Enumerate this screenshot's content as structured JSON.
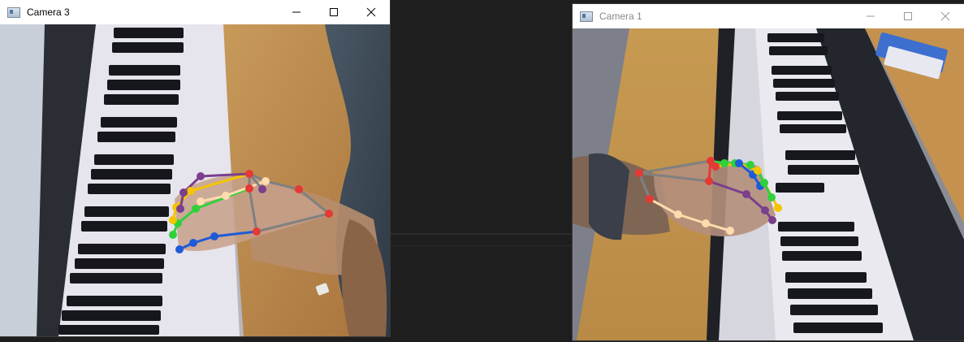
{
  "windows": {
    "camera3": {
      "title": "Camera 3"
    },
    "camera1": {
      "title": "Camera 1"
    }
  },
  "controls": {
    "minimize": "minimize-icon",
    "maximize": "maximize-icon",
    "close": "close-icon"
  },
  "colors": {
    "desktop": "#1e1e1e",
    "wrist": "#e53935",
    "thumb": "#1e5bd6",
    "index": "#2fd13a",
    "middle": "#f5c400",
    "ring": "#ffdcae",
    "pinky": "#7b3f8c",
    "palm": "#808080"
  }
}
